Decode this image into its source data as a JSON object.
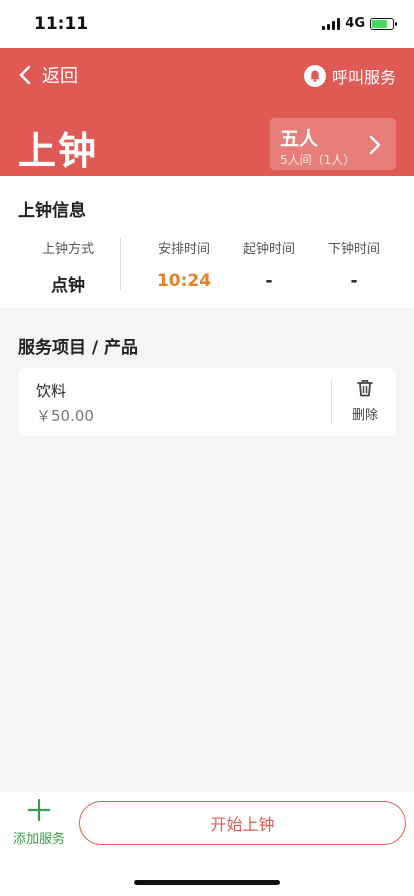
{
  "status_bar": {
    "time": "11:11",
    "network": "4G",
    "battery_level": 0.75
  },
  "header": {
    "back_label": "返回",
    "call_label": "呼叫服务",
    "title": "上钟",
    "room": {
      "name": "五人",
      "subtitle": "5人间（1人）"
    },
    "background_color": "#e05a55"
  },
  "info": {
    "title": "上钟信息",
    "columns": [
      {
        "label": "上钟方式",
        "value": "点钟"
      },
      {
        "label": "安排时间",
        "value": "10:24",
        "color": "#e8802c"
      },
      {
        "label": "起钟时间",
        "value": "-"
      },
      {
        "label": "下钟时间",
        "value": "-"
      }
    ]
  },
  "services": {
    "title": "服务项目 / 产品",
    "items": [
      {
        "name": "饮料",
        "price": "￥50.00",
        "delete_label": "删除"
      }
    ]
  },
  "bottom": {
    "add_label": "添加服务",
    "start_label": "开始上钟",
    "accent_color": "#3a9b4a"
  }
}
